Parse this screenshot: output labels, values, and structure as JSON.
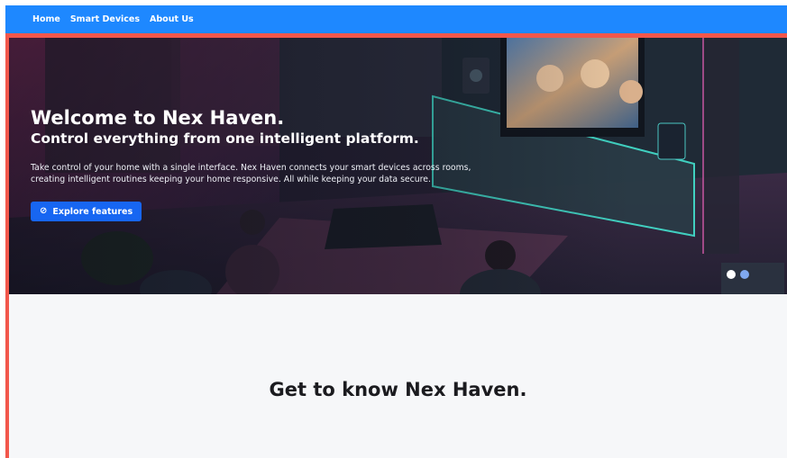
{
  "nav": {
    "items": [
      {
        "label": "Home"
      },
      {
        "label": "Smart Devices"
      },
      {
        "label": "About Us"
      }
    ]
  },
  "hero": {
    "title": "Welcome to Nex Haven.",
    "subtitle": "Control everything from one intelligent platform.",
    "description": "Take control of your home with a single interface. Nex Haven connects your smart devices across rooms, creating intelligent routines keeping your home responsive. All while keeping your data secure.",
    "cta_label": "Explore features",
    "cta_icon": "compass-icon",
    "carousel_active_slide": 1,
    "carousel_slide_count": 2
  },
  "section": {
    "title": "Get to know Nex Haven."
  },
  "colors": {
    "nav_bg": "#1e88ff",
    "accent": "#f2574b",
    "cta_bg": "#1766f2",
    "dot_active": "#ffffff",
    "dot_inactive": "#7fa8f0",
    "section_bg": "#f6f7f9"
  }
}
